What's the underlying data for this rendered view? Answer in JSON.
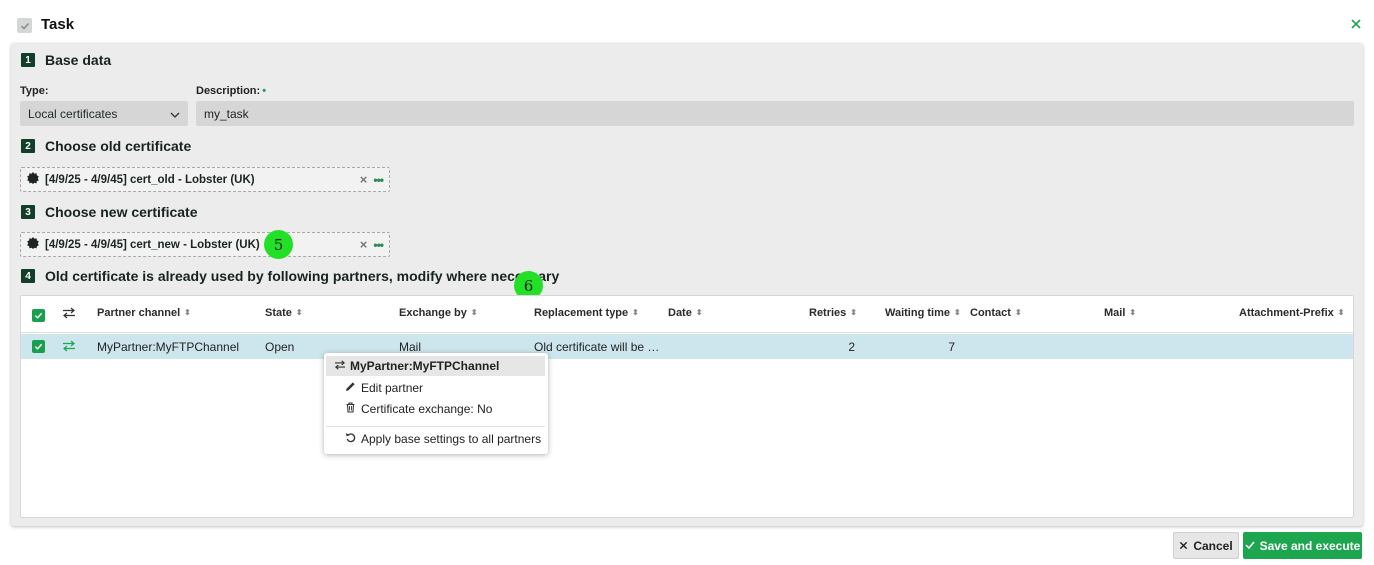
{
  "header": {
    "title": "Task"
  },
  "steps": [
    {
      "num": "1",
      "title": "Base data"
    },
    {
      "num": "2",
      "title": "Choose old certificate"
    },
    {
      "num": "3",
      "title": "Choose new certificate"
    },
    {
      "num": "4",
      "title": "Old certificate is already used by following partners, modify where necessary"
    }
  ],
  "base_data": {
    "type_label": "Type:",
    "type_value": "Local certificates",
    "description_label": "Description:",
    "description_required": "•",
    "description_value": "my_task"
  },
  "old_certificate": {
    "text": "[4/9/25 - 4/9/45] cert_old - Lobster (UK)"
  },
  "new_certificate": {
    "text": "[4/9/25 - 4/9/45] cert_new - Lobster (UK)"
  },
  "markers": {
    "five": "5",
    "six": "6"
  },
  "table": {
    "columns": [
      "Partner channel",
      "State",
      "Exchange by",
      "Replacement type",
      "Date",
      "Retries",
      "Waiting time",
      "Contact",
      "Mail",
      "Attachment-Prefix"
    ],
    "rows": [
      {
        "partner_channel": "MyPartner:MyFTPChannel",
        "state": "Open",
        "exchange_by": "Mail",
        "replacement_type": "Old certificate will be …",
        "date": "",
        "retries": "2",
        "waiting_time": "7",
        "contact": "",
        "mail": "",
        "attachment_prefix": ""
      }
    ]
  },
  "context_menu": {
    "header": "MyPartner:MyFTPChannel",
    "items": [
      "Edit partner",
      "Certificate exchange: No",
      "Apply base settings to all partners"
    ]
  },
  "footer": {
    "cancel_label": "Cancel",
    "save_label": "Save and execute"
  },
  "colors": {
    "accent": "#1ea54f",
    "step_badge": "#123f2a",
    "row_highlight": "#cde6ee",
    "marker": "#22e026"
  }
}
